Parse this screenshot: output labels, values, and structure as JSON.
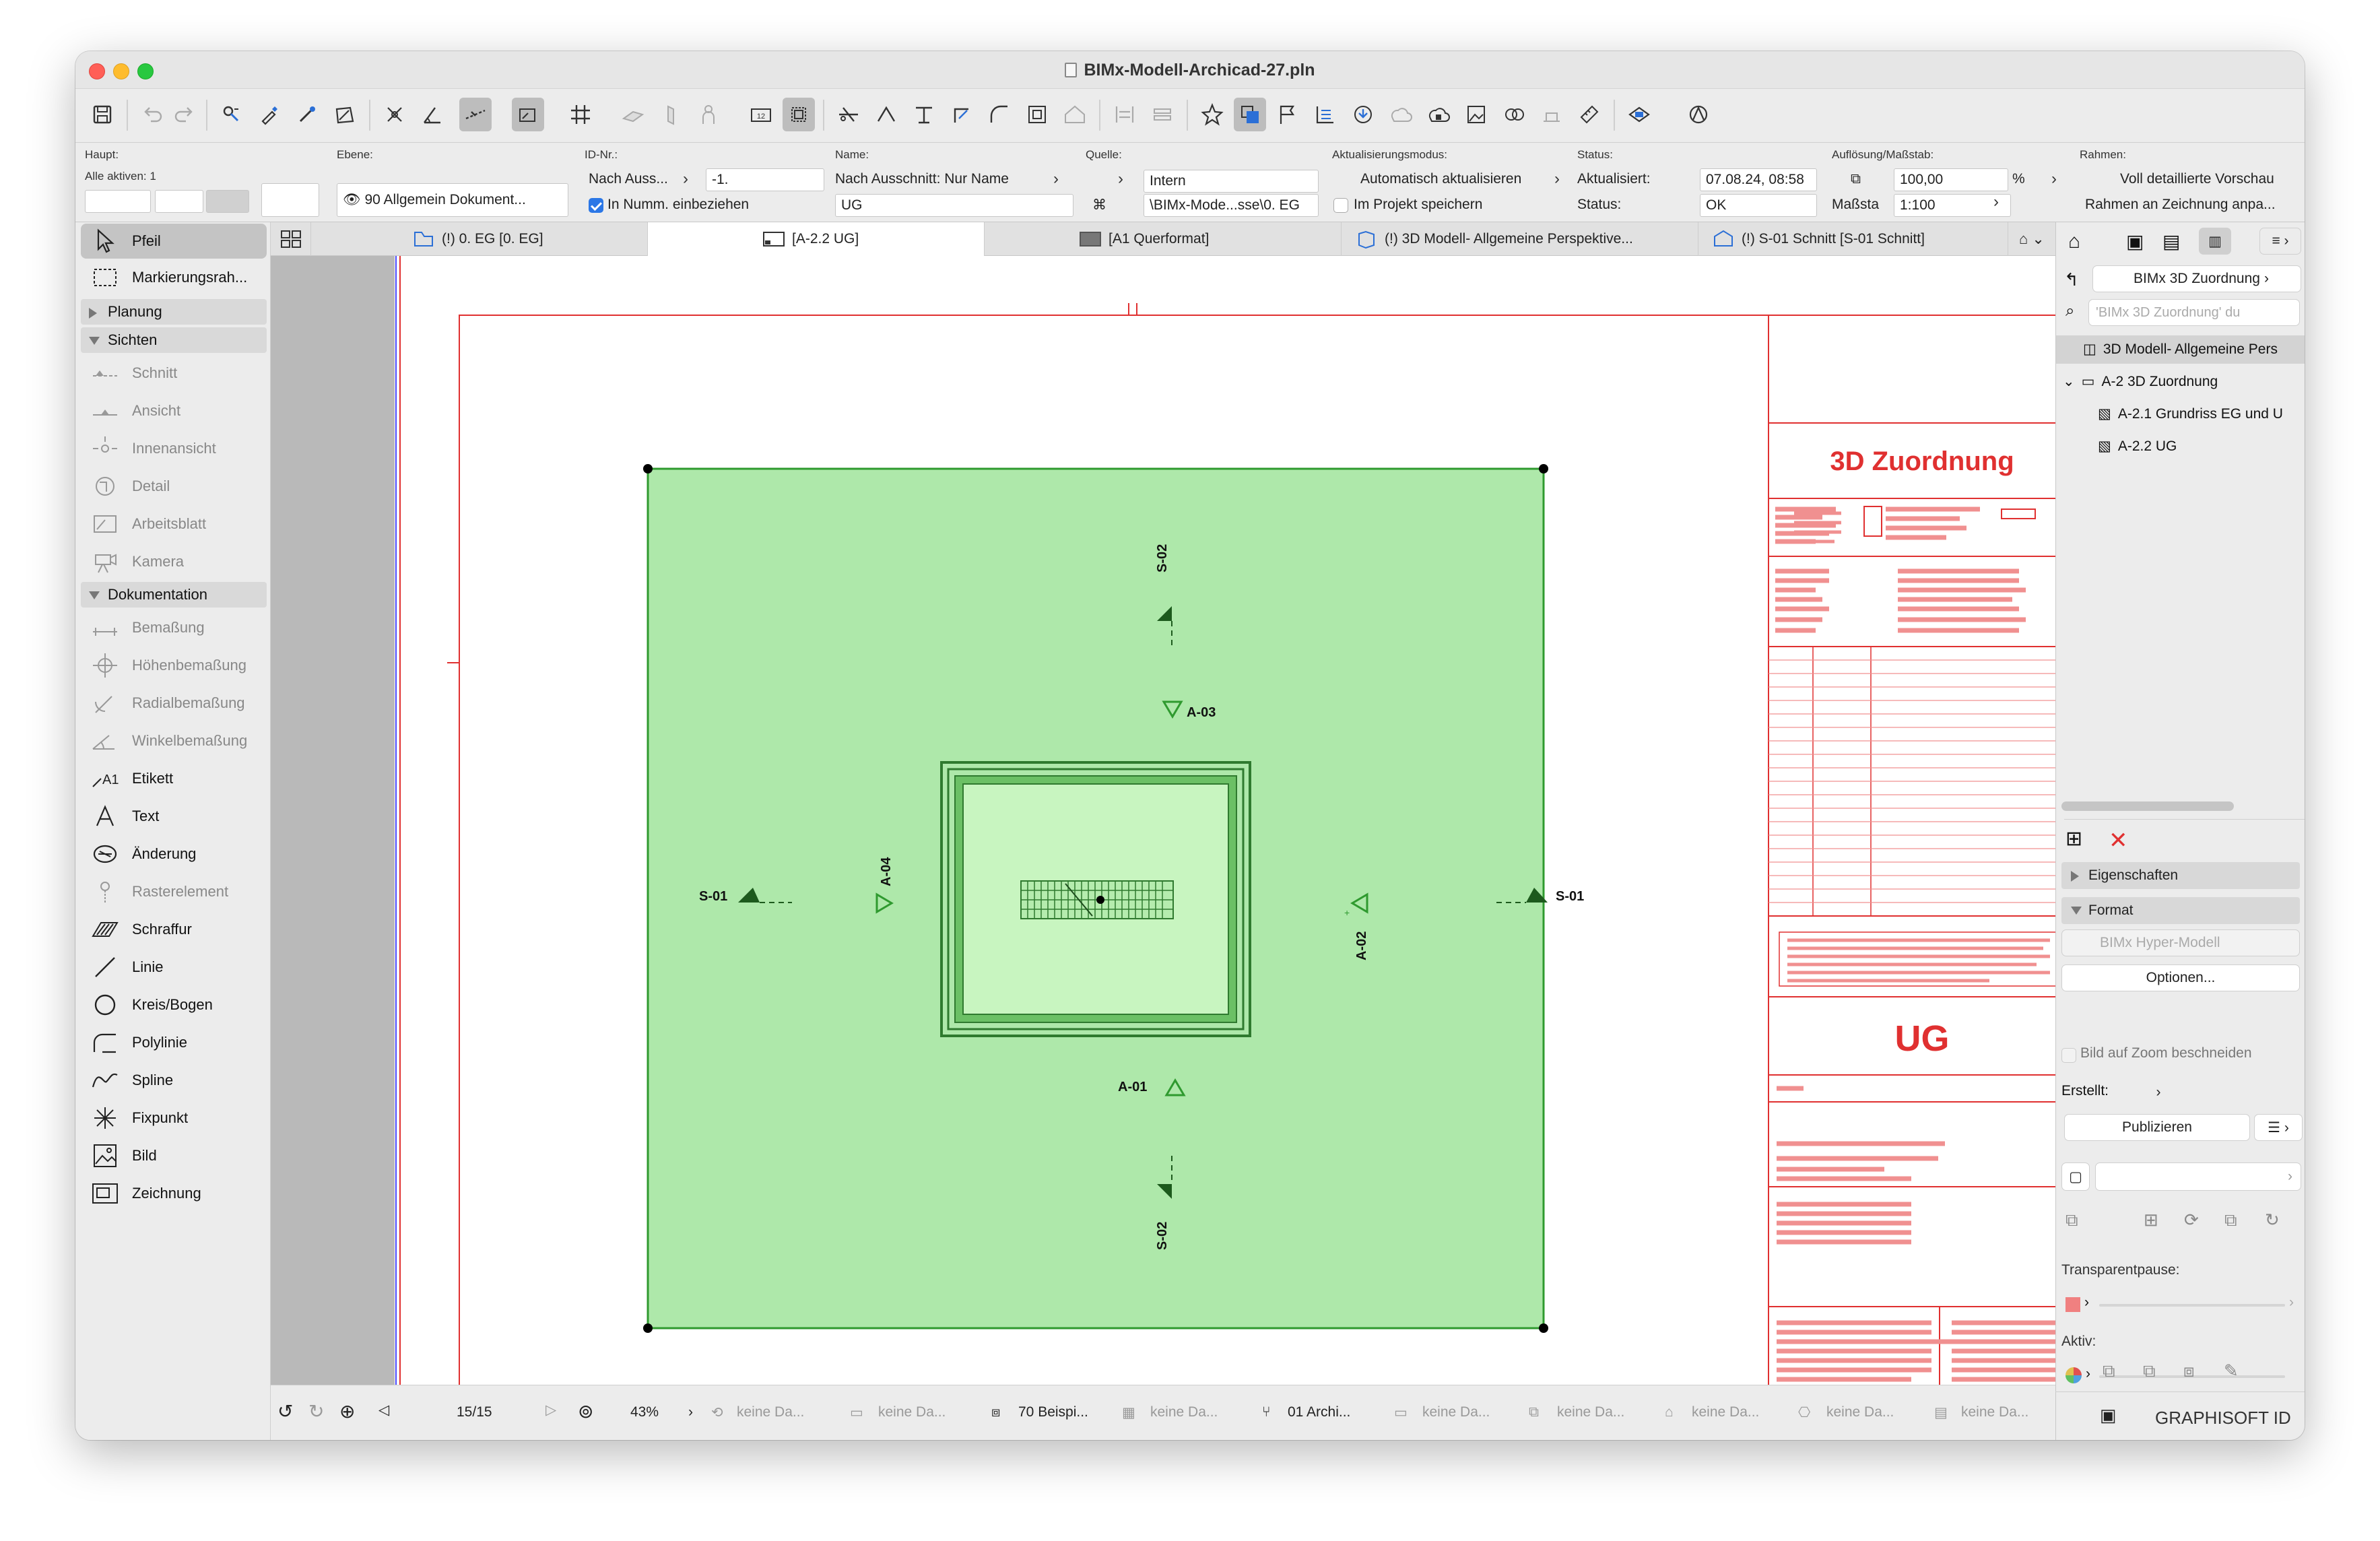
{
  "window": {
    "title": "BIMx-Modell-Archicad-27.pln"
  },
  "infobox": {
    "haupt_label": "Haupt:",
    "alle_aktiven": "Alle aktiven: 1",
    "ebene_label": "Ebene:",
    "ebene_value": "90 Allgemein Dokument...",
    "id_label": "ID-Nr.:",
    "id_mode": "Nach Auss...",
    "id_value": "-1.",
    "in_numm": "In Numm. einbeziehen",
    "name_label": "Name:",
    "name_mode": "Nach Ausschnitt: Nur Name",
    "name_value": "UG",
    "quelle_label": "Quelle:",
    "quelle_value": "Intern",
    "quelle_path": "\\BIMx-Mode...sse\\0. EG",
    "akt_modus_label": "Aktualisierungsmodus:",
    "akt_modus_value": "Automatisch aktualisieren",
    "im_projekt": "Im Projekt speichern",
    "status_label": "Status:",
    "aktualisiert_label": "Aktualisiert:",
    "aktualisiert_value": "07.08.24, 08:58",
    "status2_label": "Status:",
    "status_value": "OK",
    "aufl_label": "Auflösung/Maßstab:",
    "aufl_value": "100,00",
    "aufl_unit": "%",
    "massstab_label": "Maßsta",
    "massstab_value": "1:100",
    "rahmen_label": "Rahmen:",
    "rahmen_value1": "Voll detaillierte Vorschau",
    "rahmen_value2": "Rahmen an Zeichnung anpa..."
  },
  "toolbox": {
    "pfeil": "Pfeil",
    "markierung": "Markierungsrah...",
    "planung": "Planung",
    "sichten": "Sichten",
    "schnitt": "Schnitt",
    "ansicht": "Ansicht",
    "innenansicht": "Innenansicht",
    "detail": "Detail",
    "arbeitsblatt": "Arbeitsblatt",
    "kamera": "Kamera",
    "dokumentation": "Dokumentation",
    "bemassung": "Bemaßung",
    "hoehen": "Höhenbemaßung",
    "radial": "Radialbemaßung",
    "winkel": "Winkelbemaßung",
    "etikett": "Etikett",
    "text": "Text",
    "aenderung": "Änderung",
    "raster": "Rasterelement",
    "schraffur": "Schraffur",
    "linie": "Linie",
    "kreis": "Kreis/Bogen",
    "polylinie": "Polylinie",
    "spline": "Spline",
    "fixpunkt": "Fixpunkt",
    "bild": "Bild",
    "zeichnung": "Zeichnung"
  },
  "tabs": [
    {
      "label": "(!) 0. EG [0. EG]"
    },
    {
      "label": "[A-2.2 UG]"
    },
    {
      "label": "[A1 Querformat]"
    },
    {
      "label": "(!) 3D Modell- Allgemeine Perspektive..."
    },
    {
      "label": "(!) S-01 Schnitt [S-01 Schnitt]"
    }
  ],
  "drawing": {
    "markers": {
      "s02_top": "S-02",
      "a03": "A-03",
      "s01_left": "S-01",
      "a04": "A-04",
      "a02": "A-02",
      "s01_right": "S-01",
      "a01": "A-01",
      "s02_bottom": "S-02"
    },
    "title_block": {
      "heading": "3D Zuordnung",
      "name": "UG"
    },
    "colors": {
      "fill": "#aee8aa",
      "stroke": "#2f9a2f",
      "red": "#e03030"
    }
  },
  "statusbar": {
    "page": "15/15",
    "zoom": "43%",
    "keine": "keine Da...",
    "layer": "70 Beispi...",
    "archi": "01 Archi..."
  },
  "navigator": {
    "map_label": "BIMx 3D Zuordnung",
    "search_placeholder": "'BIMx 3D Zuordnung' du",
    "tree": [
      {
        "label": "3D Modell- Allgemeine Pers"
      },
      {
        "label": "A-2 3D Zuordnung"
      },
      {
        "label": "A-2.1 Grundriss EG und U"
      },
      {
        "label": "A-2.2 UG"
      }
    ],
    "eigenschaften": "Eigenschaften",
    "format": "Format",
    "format_value": "BIMx Hyper-Modell",
    "optionen": "Optionen...",
    "bild_zoom": "Bild auf Zoom beschneiden",
    "erstellt": "Erstellt:",
    "publizieren": "Publizieren",
    "transparent": "Transparentpause:",
    "aktiv": "Aktiv:",
    "graphisoft": "GRAPHISOFT ID"
  }
}
